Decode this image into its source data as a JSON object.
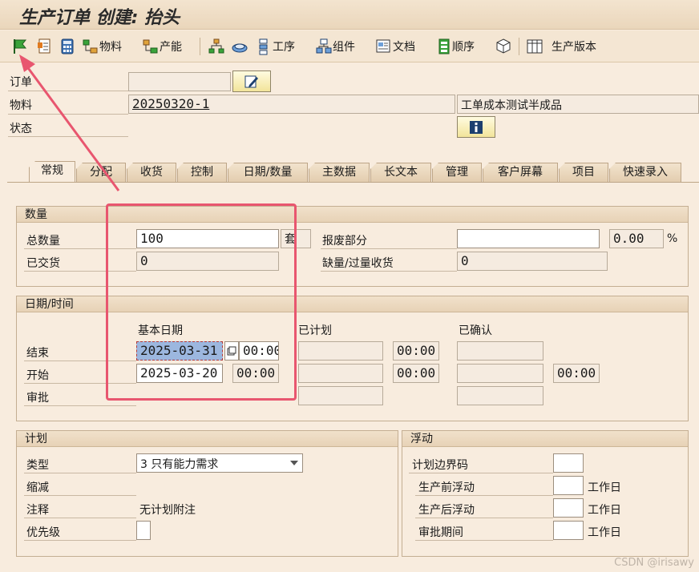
{
  "window": {
    "title": "生产订单 创建: 抬头"
  },
  "toolbar": {
    "material": "物料",
    "capacity": "产能",
    "operation": "工序",
    "component": "组件",
    "document": "文档",
    "sequence": "顺序",
    "production_version": "生产版本"
  },
  "header": {
    "order_label": "订单",
    "order_value": "",
    "material_label": "物料",
    "material_value": "20250320-1",
    "material_desc": "工单成本测试半成品",
    "status_label": "状态"
  },
  "tabs": [
    "常规",
    "分配",
    "收货",
    "控制",
    "日期/数量",
    "主数据",
    "长文本",
    "管理",
    "客户屏幕",
    "项目",
    "快速录入"
  ],
  "quantity": {
    "title": "数量",
    "total_label": "总数量",
    "total_value": "100",
    "unit": "套",
    "delivered_label": "已交货",
    "delivered_value": "0",
    "scrap_label": "报废部分",
    "scrap_value": "",
    "scrap_pct": "0.00",
    "pct_sign": "%",
    "shortfall_label": "缺量/过量收货",
    "shortfall_value": "0"
  },
  "dates": {
    "title": "日期/时间",
    "col_basic": "基本日期",
    "col_scheduled": "已计划",
    "col_confirmed": "已确认",
    "end_label": "结束",
    "end_date": "2025-03-31",
    "end_time": "00:00",
    "end_sched_time": "00:00",
    "start_label": "开始",
    "start_date": "2025-03-20",
    "start_time": "00:00",
    "start_sched_time": "00:00",
    "start_conf_time": "00:00",
    "release_label": "审批"
  },
  "planning": {
    "title": "计划",
    "type_label": "类型",
    "type_value": "3 只有能力需求",
    "reduction_label": "缩减",
    "note_label": "注释",
    "note_value": "无计划附注",
    "priority_label": "优先级",
    "priority_value": ""
  },
  "float": {
    "title": "浮动",
    "sched_margin_label": "计划边界码",
    "sched_margin_value": "",
    "before_label": "生产前浮动",
    "before_value": "",
    "after_label": "生产后浮动",
    "after_value": "",
    "release_period_label": "审批期间",
    "release_period_value": "",
    "unit": "工作日"
  },
  "watermark": "CSDN @irisawy",
  "colors": {
    "annotation": "#e8566f",
    "selection": "#9cb7df"
  }
}
